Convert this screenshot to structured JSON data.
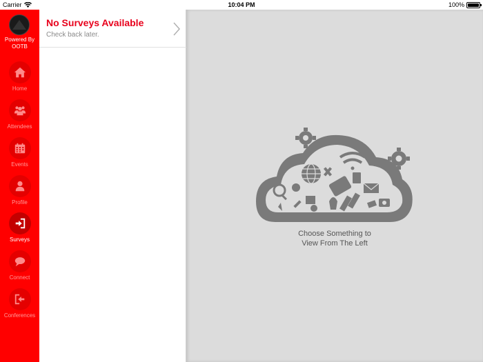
{
  "status_bar": {
    "carrier": "Carrier",
    "time": "10:04 PM",
    "battery": "100%",
    "wifi_icon": "wifi-icon",
    "battery_icon": "battery-icon"
  },
  "sidebar": {
    "powered_by": "Powered By\nOOTB",
    "items": [
      {
        "label": "Home",
        "icon": "home-icon",
        "active": false
      },
      {
        "label": "Attendees",
        "icon": "people-icon",
        "active": false
      },
      {
        "label": "Events",
        "icon": "calendar-icon",
        "active": false
      },
      {
        "label": "Profile",
        "icon": "person-icon",
        "active": false
      },
      {
        "label": "Surveys",
        "icon": "sign-in-icon",
        "active": true
      },
      {
        "label": "Connect",
        "icon": "chat-bubble-icon",
        "active": false
      },
      {
        "label": "Conferences",
        "icon": "exit-icon",
        "active": false
      }
    ],
    "colors": {
      "background": "#ff0000",
      "inactive_label": "#ff9a9a",
      "active_label": "#ffffff"
    }
  },
  "list": {
    "title": "No Surveys Available",
    "subtitle": "Check back later.",
    "chevron_icon": "chevron-right-icon",
    "title_color": "#e8001c"
  },
  "detail": {
    "message": "Choose Something to\nView From The Left",
    "illustration": "cloud-tech-icon",
    "background": "#dcdcdc"
  }
}
